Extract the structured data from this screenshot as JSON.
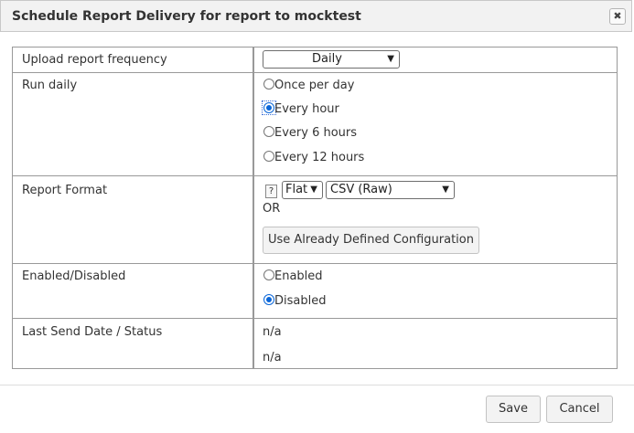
{
  "dialog": {
    "title": "Schedule Report Delivery for report to mocktest",
    "close_symbol": "✖"
  },
  "rows": {
    "frequency": {
      "label": "Upload report frequency",
      "selected": "Daily"
    },
    "run_daily": {
      "label": "Run daily",
      "options": [
        "Once per day",
        "Every hour",
        "Every 6 hours",
        "Every 12 hours"
      ],
      "selected_index": 1
    },
    "format": {
      "label": "Report Format",
      "help_symbol": "?",
      "layout_selected": "Flat",
      "format_selected": "CSV (Raw)",
      "or_text": "OR",
      "config_button": "Use Already Defined Configuration"
    },
    "enabled": {
      "label": "Enabled/Disabled",
      "options": [
        "Enabled",
        "Disabled"
      ],
      "selected_index": 1
    },
    "last_send": {
      "label": "Last Send Date / Status",
      "date_value": "n/a",
      "status_value": "n/a"
    }
  },
  "footer": {
    "save_label": "Save",
    "cancel_label": "Cancel"
  },
  "colors": {
    "accent": "#0a66d8",
    "border": "#999999",
    "titlebar_bg": "#f2f2f2"
  }
}
